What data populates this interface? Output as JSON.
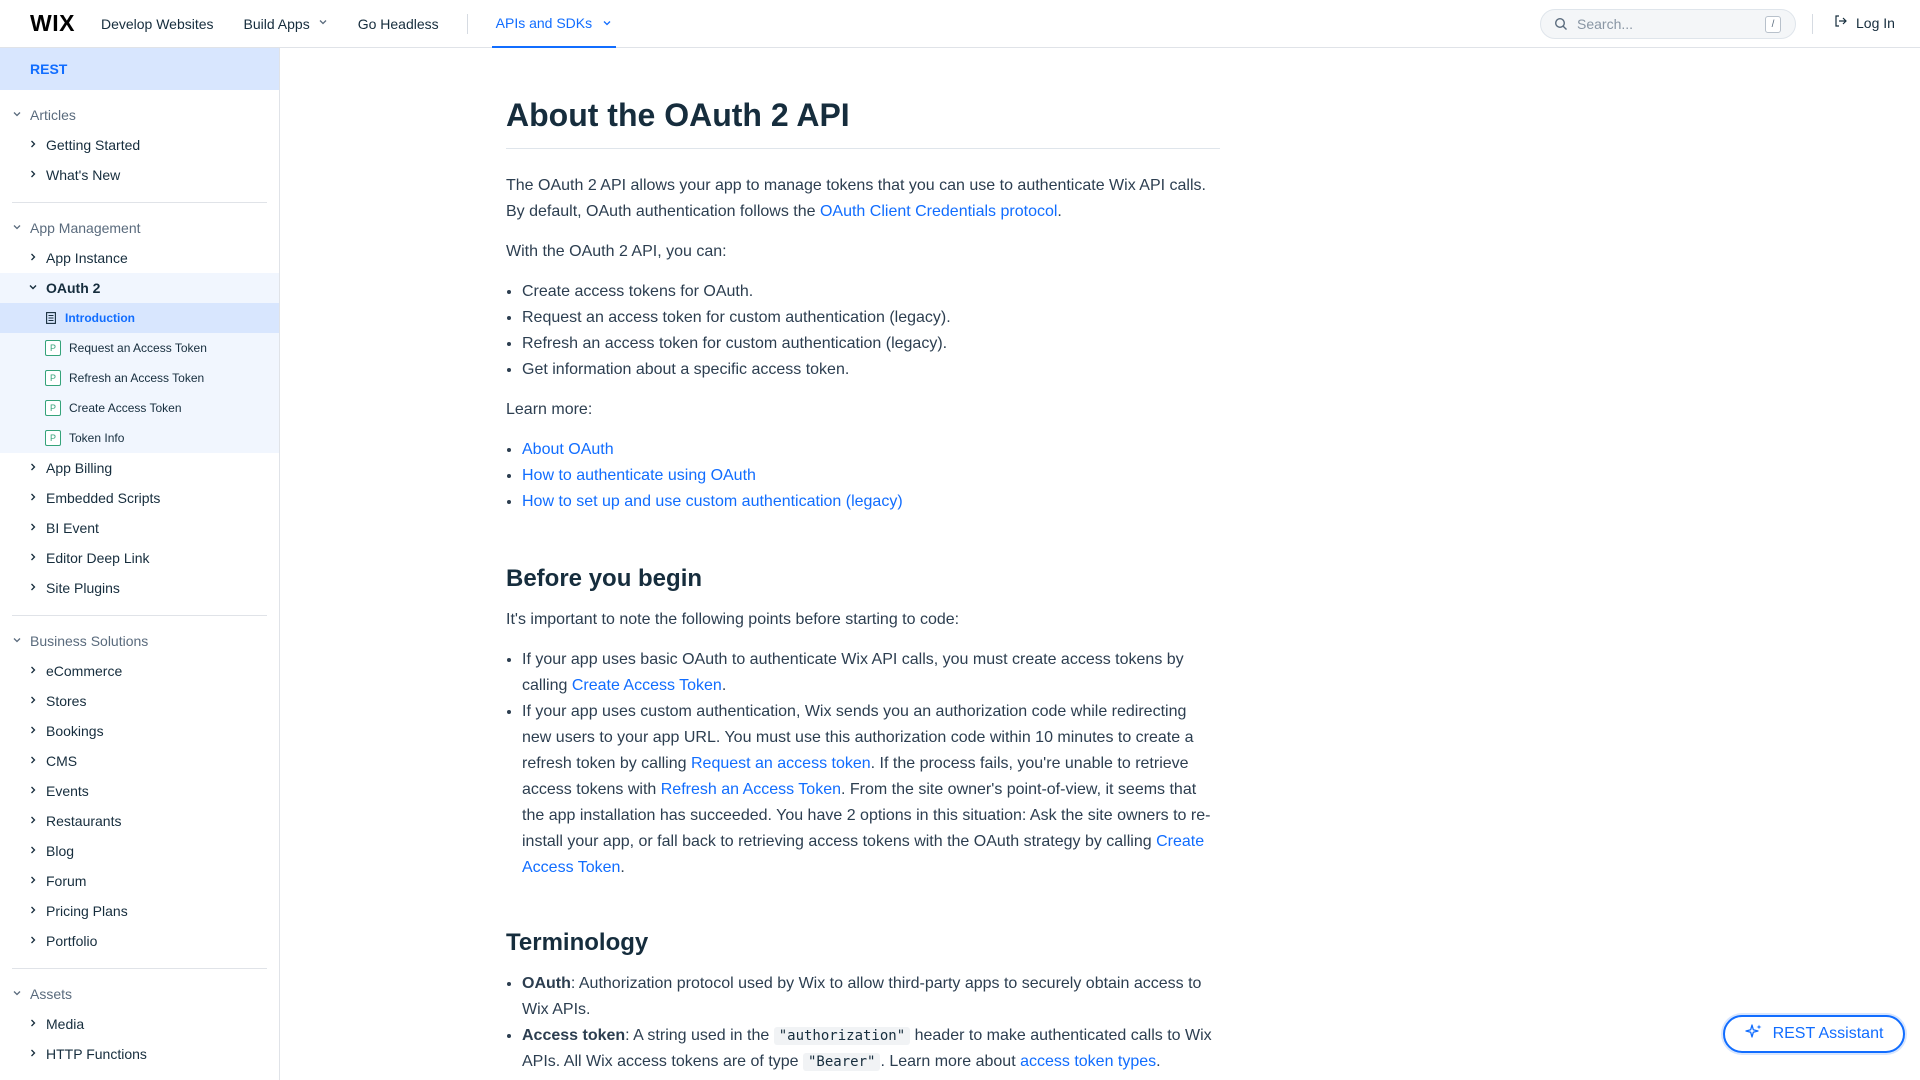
{
  "header": {
    "logo": "WIX",
    "nav": [
      {
        "label": "Develop Websites"
      },
      {
        "label": "Build Apps"
      },
      {
        "label": "Go Headless"
      }
    ],
    "active_nav": "APIs and SDKs",
    "search_placeholder": "Search...",
    "search_shortcut": "/",
    "login": "Log In"
  },
  "sidebar": {
    "root": "REST",
    "sections": [
      {
        "title": "Articles",
        "items": [
          "Getting Started",
          "What's New"
        ]
      },
      {
        "title": "App Management",
        "items_before": [
          "App Instance"
        ],
        "open_item": "OAuth 2",
        "sub_items": [
          "Introduction",
          "Request an Access Token",
          "Refresh an Access Token",
          "Create Access Token",
          "Token Info"
        ],
        "items_after": [
          "App Billing",
          "Embedded Scripts",
          "BI Event",
          "Editor Deep Link",
          "Site Plugins"
        ]
      },
      {
        "title": "Business Solutions",
        "items": [
          "eCommerce",
          "Stores",
          "Bookings",
          "CMS",
          "Events",
          "Restaurants",
          "Blog",
          "Forum",
          "Pricing Plans",
          "Portfolio"
        ]
      },
      {
        "title": "Assets",
        "items": [
          "Media",
          "HTTP Functions"
        ]
      }
    ],
    "badge_letter": "P"
  },
  "article": {
    "title": "About the OAuth 2 API",
    "intro_text": "The OAuth 2 API allows your app to manage tokens that you can use to authenticate Wix API calls. By default, OAuth authentication follows the ",
    "intro_link": "OAuth Client Credentials protocol",
    "intro_end": ".",
    "can_text": "With the OAuth 2 API, you can:",
    "can_items": [
      "Create access tokens for OAuth.",
      "Request an access token for custom authentication (legacy).",
      "Refresh an access token for custom authentication (legacy).",
      "Get information about a specific access token."
    ],
    "learn_more": "Learn more:",
    "learn_links": [
      "About OAuth",
      "How to authenticate using OAuth",
      "How to set up and use custom authentication (legacy)"
    ],
    "before_heading": "Before you begin",
    "before_text": "It's important to note the following points before starting to code:",
    "before_1_a": "If your app uses basic OAuth to authenticate Wix API calls, you must create access tokens by calling ",
    "before_1_link": "Create Access Token",
    "before_1_end": ".",
    "before_2_a": "If your app uses custom authentication, Wix sends you an authorization code while redirecting new users to your app URL. You must use this authorization code within 10 minutes to create a refresh token by calling ",
    "before_2_link1": "Request an access token",
    "before_2_b": ". If the process fails, you're unable to retrieve access tokens with ",
    "before_2_link2": "Refresh an Access Token",
    "before_2_c": ". From the site owner's point-of-view, it seems that the app installation has succeeded. You have 2 options in this situation: Ask the site owners to re-install your app, or fall back to retrieving access tokens with the OAuth strategy by calling ",
    "before_2_link3": "Create Access Token",
    "before_2_end": ".",
    "term_heading": "Terminology",
    "term_1_term": "OAuth",
    "term_1_def": ": Authorization protocol used by Wix to allow third-party apps to securely obtain access to Wix APIs.",
    "term_2_term": "Access token",
    "term_2_a": ": A string used in the ",
    "term_2_code1": "\"authorization\"",
    "term_2_b": " header to make authenticated calls to Wix APIs. All Wix access tokens are of type ",
    "term_2_code2": "\"Bearer\"",
    "term_2_c": ". Learn more about ",
    "term_2_link": "access token types",
    "term_2_end": "."
  },
  "assistant": {
    "label": "REST Assistant"
  },
  "colors": {
    "accent": "#116dff",
    "active_bg": "#d8e6fe",
    "text": "#162d3d"
  }
}
